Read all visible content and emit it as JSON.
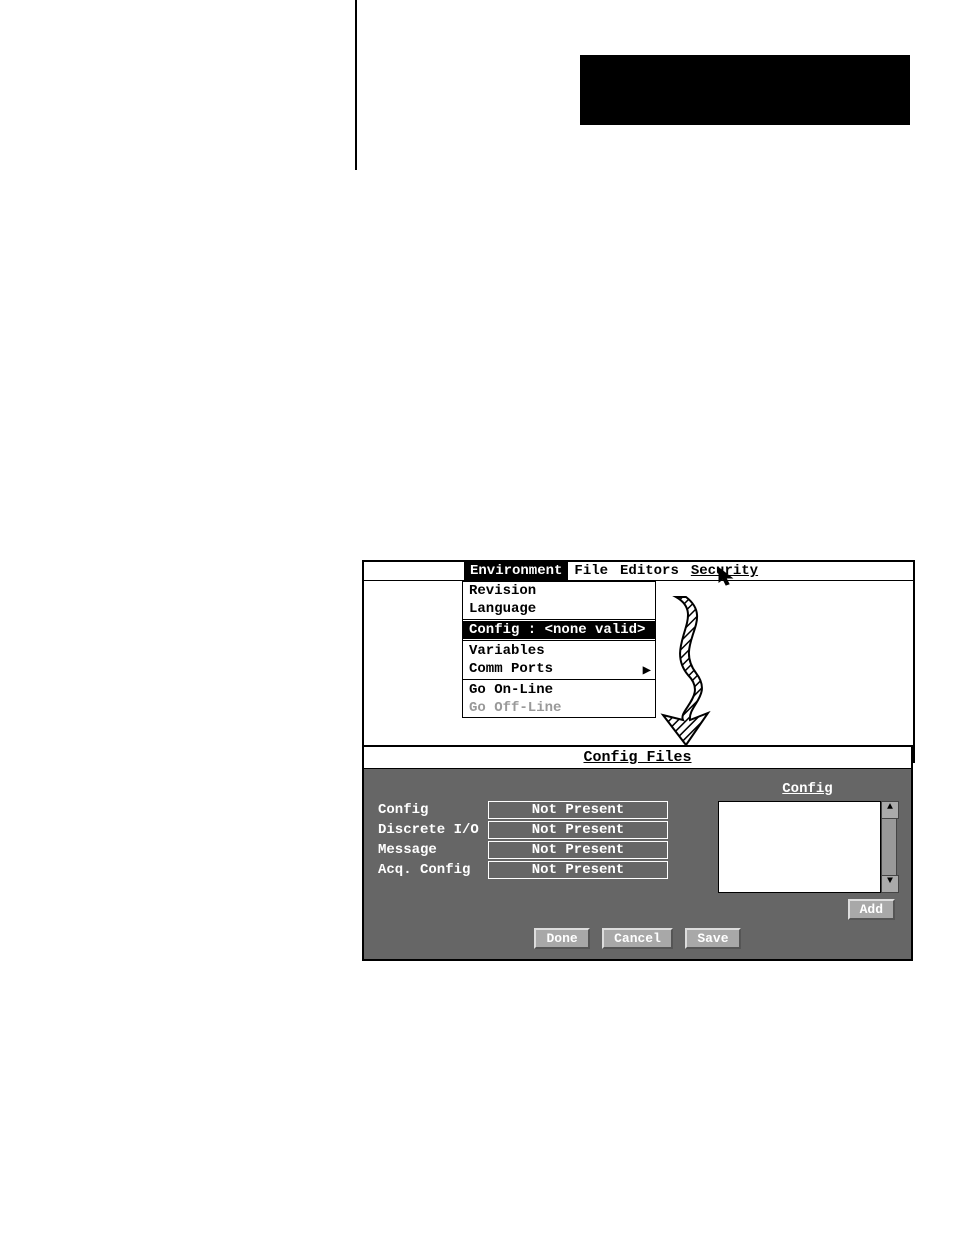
{
  "menubar": {
    "environment": "Environment",
    "file": "File",
    "editors": "Editors",
    "security": "Security"
  },
  "dropdown": {
    "revision": "Revision",
    "language": "Language",
    "config": "Config : <none valid>",
    "variables": "Variables",
    "comm_ports": "Comm Ports",
    "go_online": "Go On-Line",
    "go_offline": "Go Off-Line"
  },
  "dialog": {
    "title": "Config Files",
    "right_header": "Config",
    "rows": {
      "config_label": "Config",
      "config_status": "Not Present",
      "discrete_label": "Discrete I/O",
      "discrete_status": "Not Present",
      "message_label": "Message",
      "message_status": "Not Present",
      "acq_label": "Acq. Config",
      "acq_status": "Not Present"
    },
    "buttons": {
      "add": "Add",
      "done": "Done",
      "cancel": "Cancel",
      "save": "Save"
    }
  }
}
